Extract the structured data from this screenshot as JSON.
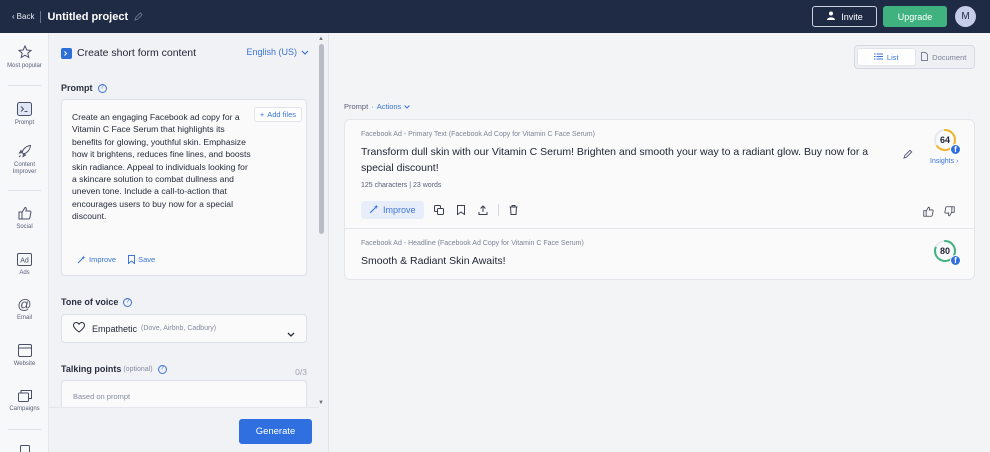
{
  "topbar": {
    "back_label": "Back",
    "project_title": "Untitled project",
    "invite_label": "Invite",
    "upgrade_label": "Upgrade",
    "avatar_initial": "M",
    "bg_color": "#1f2a44",
    "upgrade_color": "#3fb27f"
  },
  "leftnav": {
    "items": [
      {
        "label": "Most popular",
        "icon": "star-icon"
      },
      {
        "label": "Prompt",
        "icon": "terminal-icon"
      },
      {
        "label": "Content Improver",
        "icon": "rocket-icon"
      },
      {
        "label": "Social",
        "icon": "thumbs-up-icon"
      },
      {
        "label": "Ads",
        "icon": "ad-icon"
      },
      {
        "label": "Email",
        "icon": "at-icon"
      },
      {
        "label": "Website",
        "icon": "browser-icon"
      },
      {
        "label": "Campaigns",
        "icon": "layers-icon"
      }
    ]
  },
  "form": {
    "title": "Create short form content",
    "language": "English (US)",
    "prompt_label": "Prompt",
    "prompt_text": "Create an engaging Facebook ad copy for a Vitamin C Face Serum that highlights its benefits for glowing, youthful skin. Emphasize how it brightens, reduces fine lines, and boosts skin radiance. Appeal to individuals looking for a skincare solution to combat dullness and uneven tone. Include a call-to-action that encourages users to buy now for a special discount.",
    "add_files_label": "Add files",
    "improve_label": "Improve",
    "save_label": "Save",
    "tone_label": "Tone of voice",
    "tone_value": "Empathetic",
    "tone_examples": "(Dove, Airbnb, Cadbury)",
    "talking_points_label": "Talking points",
    "talking_points_optional": "(optional)",
    "talking_points_count": "0/3",
    "talking_points_placeholder": "Based on prompt",
    "generate_label": "Generate",
    "accent_color": "#2f6fe0"
  },
  "main": {
    "view_list_label": "List",
    "view_document_label": "Document",
    "prompt_label": "Prompt",
    "actions_label": "Actions",
    "results": [
      {
        "label": "Facebook Ad - Primary Text (Facebook Ad Copy for Vitamin C Face Serum)",
        "text": "Transform dull skin with our Vitamin C Serum! Brighten and smooth your way to a radiant glow. Buy now for a special discount!",
        "meta": "125 characters | 23 words",
        "score": "64",
        "score_fraction": 0.64,
        "insights_label": "Insights ›",
        "improve_label": "Improve"
      },
      {
        "label": "Facebook Ad - Headline (Facebook Ad Copy for Vitamin C Face Serum)",
        "text": "Smooth & Radiant Skin Awaits!",
        "score": "80",
        "score_fraction": 0.8
      }
    ]
  }
}
